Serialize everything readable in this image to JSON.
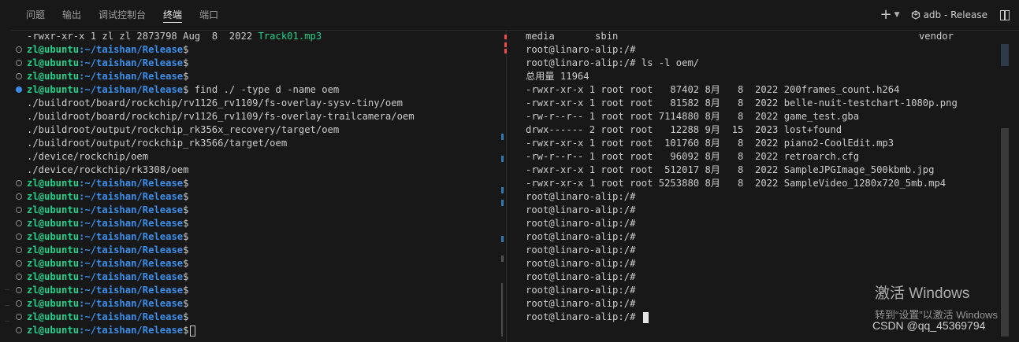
{
  "tabs": [
    "问题",
    "输出",
    "调试控制台",
    "终端",
    "端口"
  ],
  "active_tab": "终端",
  "header": {
    "add_label": "+",
    "terminal_name": "adb - Release"
  },
  "left_terminal": {
    "prompt_user": "zl@ubuntu",
    "prompt_path": ":~/taishan/Release",
    "prompt_symbol": "$",
    "lines": [
      {
        "kind": "file",
        "text": "-rwxr-xr-x 1 zl zl 2873798 Aug  8  2022 ",
        "highlight": "Track01.mp3"
      },
      {
        "kind": "prompt",
        "cmd": ""
      },
      {
        "kind": "prompt",
        "cmd": ""
      },
      {
        "kind": "prompt",
        "cmd": ""
      },
      {
        "kind": "prompt",
        "cmd": " find ./ -type d -name oem",
        "active": true
      },
      {
        "kind": "out",
        "text": "./buildroot/board/rockchip/rv1126_rv1109/fs-overlay-sysv-tiny/oem"
      },
      {
        "kind": "out",
        "text": "./buildroot/board/rockchip/rv1126_rv1109/fs-overlay-trailcamera/oem"
      },
      {
        "kind": "out",
        "text": "./buildroot/output/rockchip_rk356x_recovery/target/oem"
      },
      {
        "kind": "out",
        "text": "./buildroot/output/rockchip_rk3566/target/oem"
      },
      {
        "kind": "out",
        "text": "./device/rockchip/oem"
      },
      {
        "kind": "out",
        "text": "./device/rockchip/rk3308/oem"
      },
      {
        "kind": "prompt",
        "cmd": ""
      },
      {
        "kind": "prompt",
        "cmd": ""
      },
      {
        "kind": "prompt",
        "cmd": ""
      },
      {
        "kind": "prompt",
        "cmd": ""
      },
      {
        "kind": "prompt",
        "cmd": ""
      },
      {
        "kind": "prompt",
        "cmd": ""
      },
      {
        "kind": "prompt",
        "cmd": ""
      },
      {
        "kind": "prompt",
        "cmd": ""
      },
      {
        "kind": "prompt",
        "cmd": ""
      },
      {
        "kind": "prompt",
        "cmd": ""
      },
      {
        "kind": "prompt",
        "cmd": ""
      },
      {
        "kind": "prompt",
        "cmd": "",
        "cursor": true
      }
    ]
  },
  "right_terminal": {
    "lines": [
      "media       sbin                                                    vendor",
      "root@linaro-alip:/#",
      "root@linaro-alip:/# ls -l oem/",
      "总用量 11964",
      "-rwxr-xr-x 1 root root   87402 8月   8  2022 200frames_count.h264",
      "-rwxr-xr-x 1 root root   81582 8月   8  2022 belle-nuit-testchart-1080p.png",
      "-rw-r--r-- 1 root root 7114880 8月   8  2022 game_test.gba",
      "drwx------ 2 root root   12288 9月  15  2023 lost+found",
      "-rwxr-xr-x 1 root root  101760 8月   8  2022 piano2-CoolEdit.mp3",
      "-rw-r--r-- 1 root root   96092 8月   8  2022 retroarch.cfg",
      "-rwxr-xr-x 1 root root  512017 8月   8  2022 SampleJPGImage_500kbmb.jpg",
      "-rwxr-xr-x 1 root root 5253880 8月   8  2022 SampleVideo_1280x720_5mb.mp4",
      "root@linaro-alip:/#",
      "root@linaro-alip:/#",
      "root@linaro-alip:/#",
      "root@linaro-alip:/#",
      "root@linaro-alip:/#",
      "root@linaro-alip:/#",
      "root@linaro-alip:/#",
      "root@linaro-alip:/#",
      "root@linaro-alip:/#",
      "root@linaro-alip:/# "
    ]
  },
  "watermark": {
    "line1": "激活 Windows",
    "line2": "转到“设置”以激活 Windows"
  },
  "csdn_watermark": "CSDN @qq_45369794",
  "colors": {
    "prompt_user": "#23d18b",
    "prompt_path": "#3b8eea",
    "background": "#181818",
    "text": "#cccccc"
  }
}
